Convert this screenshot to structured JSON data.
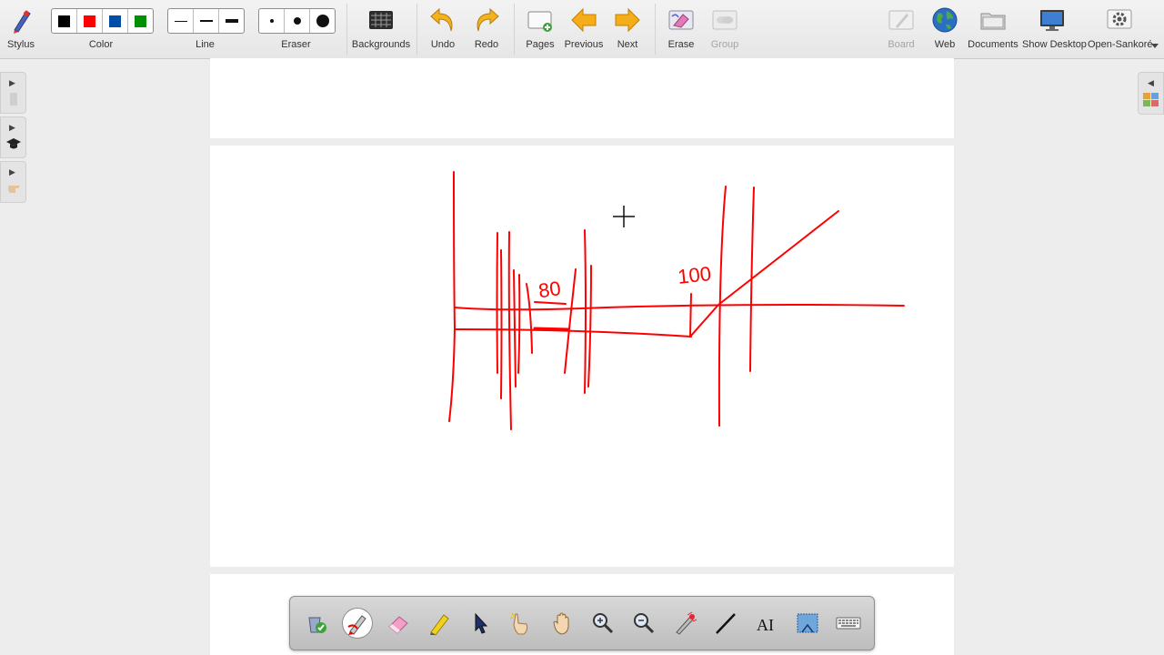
{
  "toolbar": {
    "stylus": "Stylus",
    "color": "Color",
    "line": "Line",
    "eraser": "Eraser",
    "backgrounds": "Backgrounds",
    "undo": "Undo",
    "redo": "Redo",
    "pages": "Pages",
    "previous": "Previous",
    "next": "Next",
    "erase": "Erase",
    "group": "Group",
    "board": "Board",
    "web": "Web",
    "documents": "Documents",
    "show_desktop": "Show Desktop",
    "open_sankore": "Open-Sankoré",
    "colors": [
      "#000000",
      "#ff0000",
      "#004da8",
      "#009100"
    ]
  },
  "drawing": {
    "ink_color": "#ff0000",
    "annotations": [
      "80",
      "100"
    ]
  },
  "palette": {
    "tools": [
      "paint-bucket",
      "pen",
      "eraser",
      "highlighter",
      "selector",
      "interact",
      "hand",
      "zoom-in",
      "zoom-out",
      "laser-pointer",
      "line",
      "text",
      "capture",
      "keyboard"
    ],
    "active": "pen"
  }
}
